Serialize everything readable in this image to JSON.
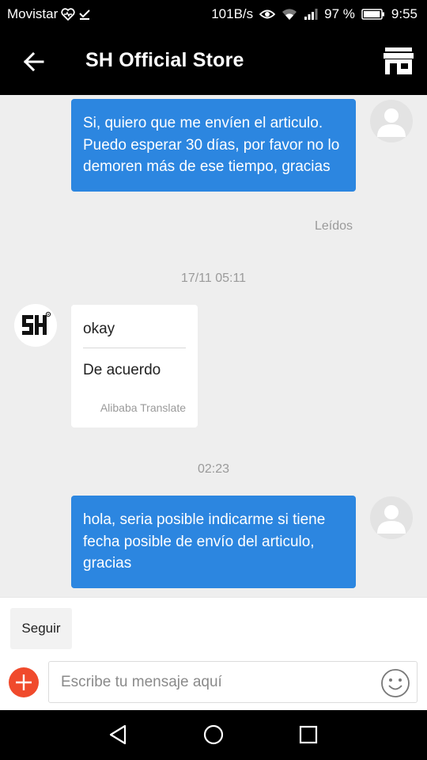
{
  "status_bar": {
    "carrier": "Movistar",
    "net_speed": "101B/s",
    "battery_percent": "97 %",
    "time": "9:55",
    "battery_level": 0.97
  },
  "header": {
    "title": "SH Official Store"
  },
  "messages": {
    "sent_1": "Si, quiero que me envíen el articulo. Puedo esperar 30 días, por favor no lo demoren más de ese tiempo, gracias",
    "read_status": "Leídos",
    "timestamp_1": "17/11 05:11",
    "received_original": "okay",
    "received_translation": "De acuerdo",
    "translation_credit": "Alibaba Translate",
    "timestamp_2": "02:23",
    "sent_2": "hola, seria posible indicarme si tiene fecha posible de envío del articulo, gracias"
  },
  "composer": {
    "follow_label": "Seguir",
    "placeholder": "Escribe tu mensaje aquí"
  },
  "colors": {
    "accent": "#2c86e0",
    "plus": "#f04a2c",
    "chat_bg": "#eeeeee"
  },
  "icons": {
    "back": "arrow-left-icon",
    "store": "store-icon",
    "emoji": "smiley-icon",
    "plus": "plus-icon"
  }
}
